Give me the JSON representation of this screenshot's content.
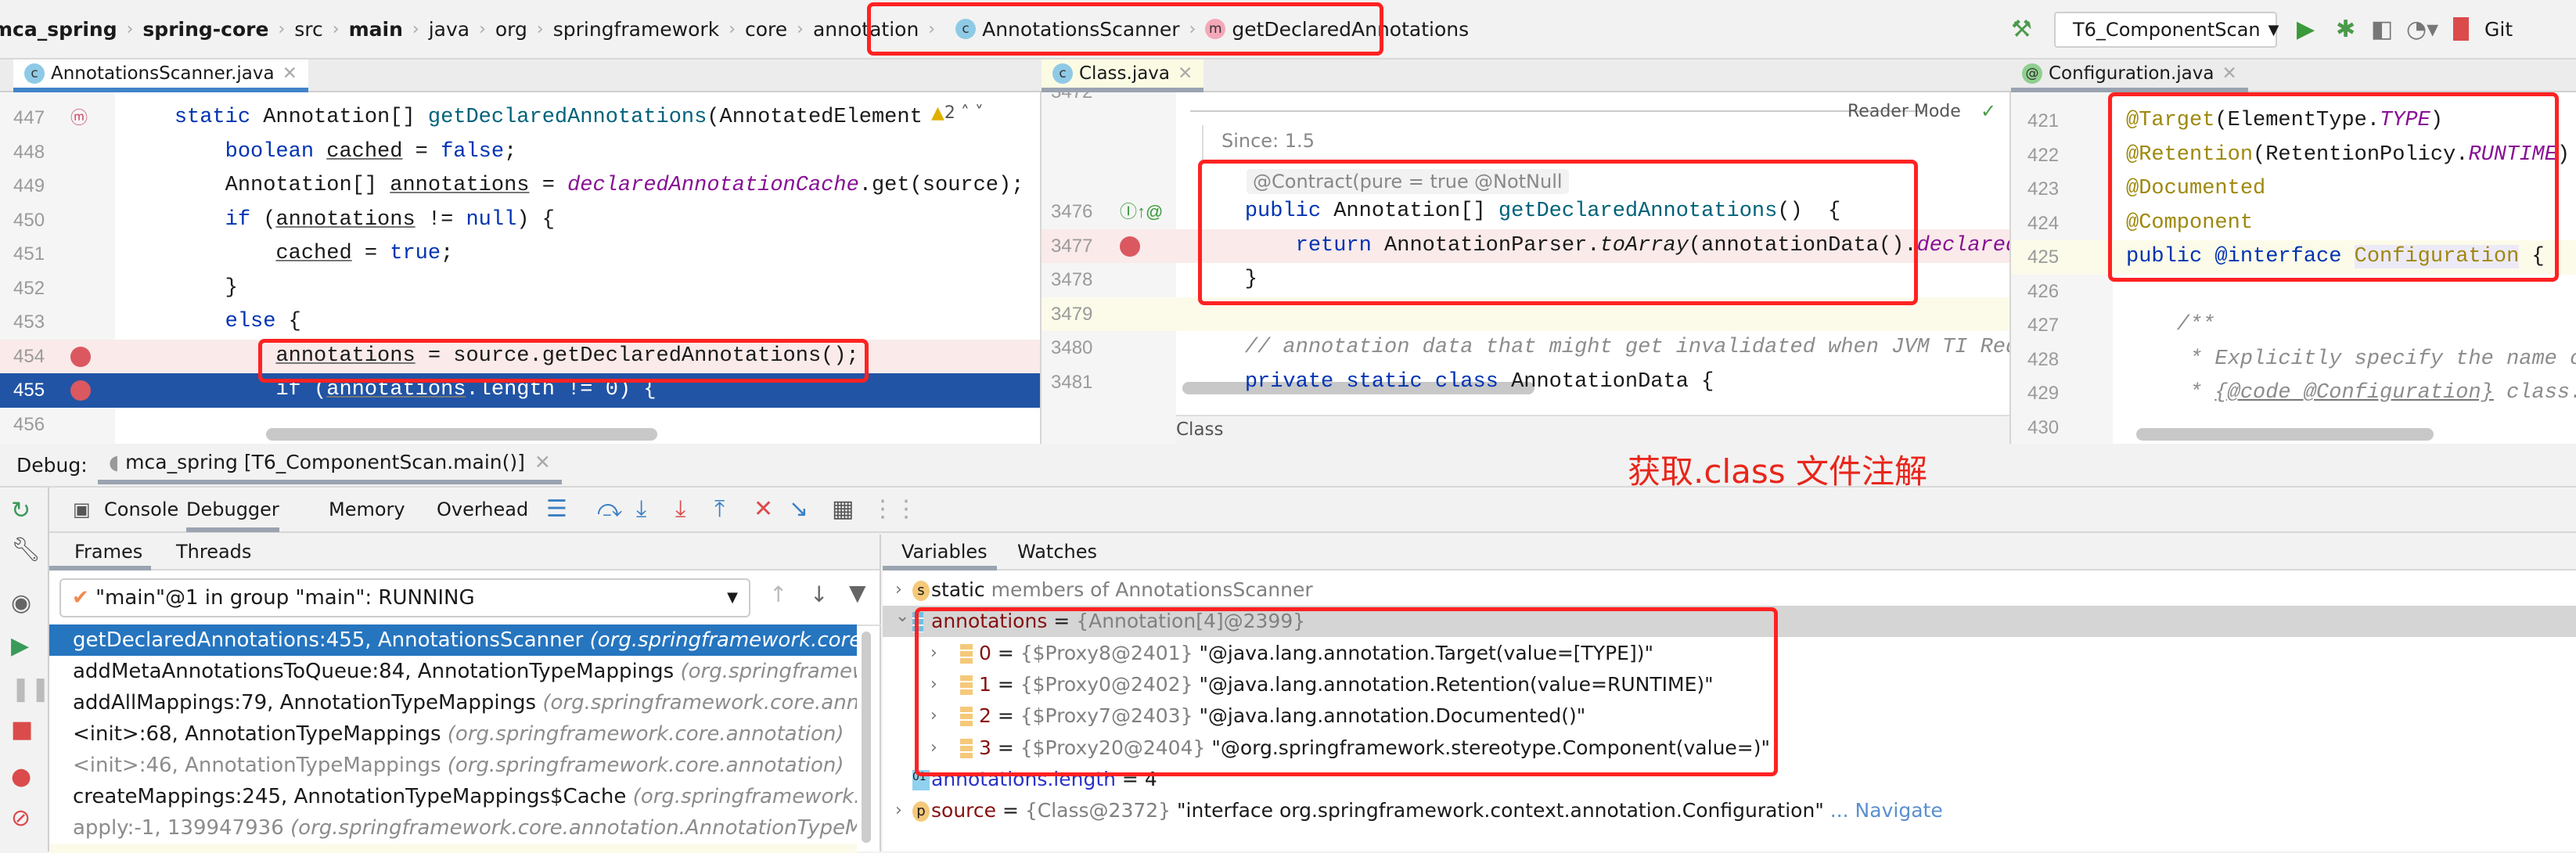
{
  "breadcrumb": {
    "items": [
      {
        "label": "mca_spring",
        "bold": true
      },
      {
        "label": "spring-core",
        "bold": true
      },
      {
        "label": "src"
      },
      {
        "label": "main",
        "bold": true
      },
      {
        "label": "java"
      },
      {
        "label": "org"
      },
      {
        "label": "springframework"
      },
      {
        "label": "core"
      },
      {
        "label": "annotation"
      }
    ],
    "class_item": "AnnotationsScanner",
    "method_item": "getDeclaredAnnotations"
  },
  "toolbar": {
    "run_config": "T6_ComponentScan",
    "git": "Git"
  },
  "tabs": [
    {
      "label": "AnnotationsScanner.java"
    },
    {
      "label": "Class.java"
    },
    {
      "label": "Configuration.java"
    }
  ],
  "left_editor": {
    "inspection_count": "2",
    "lines": [
      {
        "n": "447",
        "g": "override",
        "t": [
          [
            "    "
          ],
          [
            "static",
            "kw"
          ],
          [
            " Annotation[] "
          ],
          [
            "getDeclaredAnnotations",
            "fn"
          ],
          [
            "(AnnotatedElement"
          ]
        ]
      },
      {
        "n": "448",
        "t": [
          [
            "        "
          ],
          [
            "boolean",
            "kw"
          ],
          [
            " "
          ],
          [
            "cached",
            "ul"
          ],
          [
            " = "
          ],
          [
            "false",
            "kw"
          ],
          [
            ";"
          ]
        ]
      },
      {
        "n": "449",
        "t": [
          [
            "        Annotation[] "
          ],
          [
            "annotations",
            "ul"
          ],
          [
            " = "
          ],
          [
            "declaredAnnotationCache",
            "st"
          ],
          [
            ".get(source);"
          ]
        ]
      },
      {
        "n": "450",
        "t": [
          [
            "        "
          ],
          [
            "if",
            "kw"
          ],
          [
            " ("
          ],
          [
            "annotations",
            "ul"
          ],
          [
            " != "
          ],
          [
            "null",
            "kw"
          ],
          [
            ") {"
          ]
        ]
      },
      {
        "n": "451",
        "t": [
          [
            "            "
          ],
          [
            "cached",
            "ul"
          ],
          [
            " = "
          ],
          [
            "true",
            "kw"
          ],
          [
            ";"
          ]
        ]
      },
      {
        "n": "452",
        "t": [
          [
            "        }"
          ]
        ]
      },
      {
        "n": "453",
        "t": [
          [
            "        "
          ],
          [
            "else",
            "kw"
          ],
          [
            " {"
          ]
        ]
      },
      {
        "n": "454",
        "g": "breakpoint",
        "bg": "bp",
        "t": [
          [
            "            "
          ],
          [
            "annotations",
            "ul"
          ],
          [
            " = source.getDeclaredAnnotations();"
          ]
        ]
      },
      {
        "n": "455",
        "g": "breakpoint",
        "bg": "sel",
        "t": [
          [
            "            "
          ],
          [
            "if",
            "kw"
          ],
          [
            " ("
          ],
          [
            "annotations",
            "ul"
          ],
          [
            ".length != 0) {"
          ]
        ]
      },
      {
        "n": "456",
        "t": [
          [
            ""
          ]
        ]
      }
    ]
  },
  "middle_editor": {
    "top_line": "3472",
    "reader_mode": "Reader Mode",
    "since": "Since: 1.5",
    "annotations_hint": [
      "@Contract(pure = true)",
      "@NotNull"
    ],
    "status": "Class",
    "lines": [
      {
        "n": "3476",
        "g": "implements",
        "t": [
          [
            "    "
          ],
          [
            "public",
            "kw"
          ],
          [
            " Annotation[] "
          ],
          [
            "getDeclaredAnnotations",
            "fn"
          ],
          [
            "()  {"
          ]
        ]
      },
      {
        "n": "3477",
        "g": "breakpoint",
        "bg": "bp",
        "t": [
          [
            "        "
          ],
          [
            "return",
            "kw"
          ],
          [
            " AnnotationParser."
          ],
          [
            "toArray",
            "it"
          ],
          [
            "(annotationData()."
          ],
          [
            "declaredAnnotations",
            "st"
          ]
        ]
      },
      {
        "n": "3478",
        "t": [
          [
            "    }"
          ]
        ]
      },
      {
        "n": "3479",
        "bg": "cur",
        "t": [
          [
            ""
          ]
        ]
      },
      {
        "n": "3480",
        "t": [
          [
            "    // annotation data that might get invalidated when JVM TI RedefineClasses",
            "cm"
          ]
        ]
      },
      {
        "n": "3481",
        "t": [
          [
            "    "
          ],
          [
            "private static class",
            "kw"
          ],
          [
            " AnnotationData {"
          ]
        ]
      }
    ]
  },
  "right_editor": {
    "lines": [
      {
        "n": "421",
        "t": [
          [
            "@Target",
            "an"
          ],
          [
            "(ElementType."
          ],
          [
            "TYPE",
            "st"
          ],
          [
            ")"
          ]
        ]
      },
      {
        "n": "422",
        "t": [
          [
            "@Retention",
            "an"
          ],
          [
            "(RetentionPolicy."
          ],
          [
            "RUNTIME",
            "st"
          ],
          [
            ")"
          ]
        ]
      },
      {
        "n": "423",
        "t": [
          [
            "@Documented",
            "an"
          ]
        ]
      },
      {
        "n": "424",
        "t": [
          [
            "@Component",
            "an"
          ]
        ]
      },
      {
        "n": "425",
        "bg": "cur",
        "t": [
          [
            "public",
            "kw"
          ],
          [
            " "
          ],
          [
            "@interface",
            "kw"
          ],
          [
            " "
          ],
          [
            "Configuration",
            "cls"
          ],
          [
            " {"
          ]
        ]
      },
      {
        "n": "426",
        "t": [
          [
            ""
          ]
        ]
      },
      {
        "n": "427",
        "t": [
          [
            "    /**",
            "cm"
          ]
        ]
      },
      {
        "n": "428",
        "t": [
          [
            "     * Explicitly specify the name of the Spring bean",
            "cm"
          ]
        ]
      },
      {
        "n": "429",
        "t": [
          [
            "     * ",
            "cm"
          ],
          [
            "{@code @Configuration}",
            "cm ul"
          ],
          [
            " class.",
            "cm"
          ]
        ]
      },
      {
        "n": "430",
        "t": [
          [
            ""
          ]
        ]
      }
    ]
  },
  "debug": {
    "label": "Debug:",
    "session": "mca_spring [T6_ComponentScan.main()]",
    "note": "获取.class 文件注解",
    "note_color": "#e8261b",
    "tabs": [
      "Console",
      "Debugger",
      "Memory",
      "Overhead"
    ],
    "subtabs_left": [
      "Frames",
      "Threads"
    ],
    "subtabs_right": [
      "Variables",
      "Watches"
    ],
    "thread": "\"main\"@1 in group \"main\": RUNNING",
    "frames": [
      {
        "m": "getDeclaredAnnotations:455, AnnotationsScanner ",
        "p": "(org.springframework.core.annotation)",
        "sel": true
      },
      {
        "m": "addMetaAnnotationsToQueue:84, AnnotationTypeMappings ",
        "p": "(org.springframework.core.annotation)"
      },
      {
        "m": "addAllMappings:79, AnnotationTypeMappings ",
        "p": "(org.springframework.core.annotation)"
      },
      {
        "m": "<init>:68, AnnotationTypeMappings ",
        "p": "(org.springframework.core.annotation)"
      },
      {
        "m": "<init>:46, AnnotationTypeMappings ",
        "p": "(org.springframework.core.annotation)",
        "dim": true
      },
      {
        "m": "createMappings:245, AnnotationTypeMappings$Cache ",
        "p": "(org.springframework.core.annotation)"
      },
      {
        "m": "apply:-1, 139947936 ",
        "p": "(org.springframework.core.annotation.AnnotationTypeMappings$Cache)",
        "dim": true
      }
    ],
    "variables": [
      {
        "icon": "s",
        "arrow": "right",
        "lvl": 0,
        "name": "static",
        "rest": " members of AnnotationsScanner",
        "kind": "static"
      },
      {
        "icon": "array",
        "arrow": "down",
        "lvl": 0,
        "name": "annotations",
        "eq": " = ",
        "val": "{Annotation[4]@2399}",
        "hl": true
      },
      {
        "icon": "field",
        "arrow": "right",
        "lvl": 1,
        "name": "0",
        "eq": " = ",
        "val": "{$Proxy8@2401} ",
        "str": "\"@java.lang.annotation.Target(value=[TYPE])\""
      },
      {
        "icon": "field",
        "arrow": "right",
        "lvl": 1,
        "name": "1",
        "eq": " = ",
        "val": "{$Proxy0@2402} ",
        "str": "\"@java.lang.annotation.Retention(value=RUNTIME)\""
      },
      {
        "icon": "field",
        "arrow": "right",
        "lvl": 1,
        "name": "2",
        "eq": " = ",
        "val": "{$Proxy7@2403} ",
        "str": "\"@java.lang.annotation.Documented()\""
      },
      {
        "icon": "field",
        "arrow": "right",
        "lvl": 1,
        "name": "3",
        "eq": " = ",
        "val": "{$Proxy20@2404} ",
        "str": "\"@org.springframework.stereotype.Component(value=)\""
      },
      {
        "icon": "01",
        "lvl": 0,
        "name": "annotations.length",
        "eq": " = ",
        "str": "4",
        "kind": "watch"
      },
      {
        "icon": "p",
        "arrow": "right",
        "lvl": 0,
        "name": "source",
        "eq": " = ",
        "val": "{Class@2372} ",
        "str": "\"interface org.springframework.context.annotation.Configuration\"",
        "link": " ... Navigate"
      }
    ]
  }
}
